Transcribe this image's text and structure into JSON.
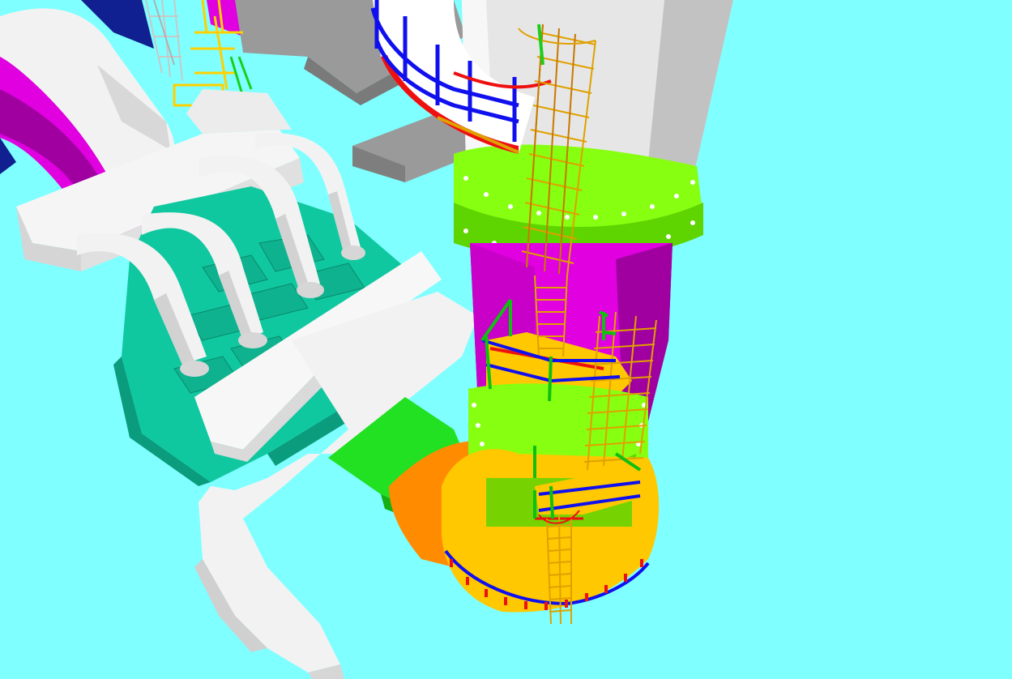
{
  "scene": {
    "background": "#7fffff",
    "colors": {
      "pipe_white": "#f2f2f2",
      "pipe_shade": "#d2d2d2",
      "tower_gray": "#e3e3e3",
      "magenta": "#e000e0",
      "magenta_dark": "#a000a0",
      "teal": "#10c8a0",
      "teal_dark": "#0a9c7c",
      "lime": "#86ff10",
      "lime_dark": "#5ed400",
      "green": "#22e022",
      "orange": "#ff8c00",
      "yellow_orange": "#ffc800",
      "rail_blue": "#1010ee",
      "rail_red": "#ee1010",
      "rail_green": "#10c010",
      "ladder": "#e0a000",
      "dark_blue": "#102090",
      "gray": "#9a9a9a"
    }
  }
}
